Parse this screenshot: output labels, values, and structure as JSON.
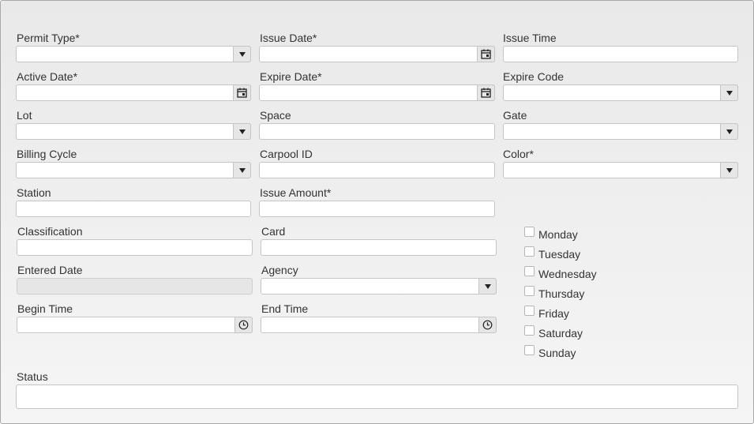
{
  "form": {
    "permit_type": {
      "label": "Permit Type*",
      "value": ""
    },
    "issue_date": {
      "label": "Issue Date*",
      "value": ""
    },
    "issue_time": {
      "label": "Issue Time",
      "value": ""
    },
    "active_date": {
      "label": "Active Date*",
      "value": ""
    },
    "expire_date": {
      "label": "Expire Date*",
      "value": ""
    },
    "expire_code": {
      "label": "Expire Code",
      "value": ""
    },
    "lot": {
      "label": "Lot",
      "value": ""
    },
    "space": {
      "label": "Space",
      "value": ""
    },
    "gate": {
      "label": "Gate",
      "value": ""
    },
    "billing_cycle": {
      "label": "Billing Cycle",
      "value": ""
    },
    "carpool_id": {
      "label": "Carpool ID",
      "value": ""
    },
    "color": {
      "label": "Color*",
      "value": ""
    },
    "station": {
      "label": "Station",
      "value": ""
    },
    "issue_amount": {
      "label": "Issue Amount*",
      "value": ""
    },
    "classification": {
      "label": "Classification",
      "value": ""
    },
    "card": {
      "label": "Card",
      "value": ""
    },
    "entered_date": {
      "label": "Entered Date",
      "value": ""
    },
    "agency": {
      "label": "Agency",
      "value": ""
    },
    "begin_time": {
      "label": "Begin Time",
      "value": ""
    },
    "end_time": {
      "label": "End Time",
      "value": ""
    },
    "status": {
      "label": "Status",
      "value": ""
    }
  },
  "days": [
    {
      "label": "Monday",
      "checked": false
    },
    {
      "label": "Tuesday",
      "checked": false
    },
    {
      "label": "Wednesday",
      "checked": false
    },
    {
      "label": "Thursday",
      "checked": false
    },
    {
      "label": "Friday",
      "checked": false
    },
    {
      "label": "Saturday",
      "checked": false
    },
    {
      "label": "Sunday",
      "checked": false
    }
  ],
  "icons": {
    "dropdown": "chevron-down-icon",
    "date": "calendar-icon",
    "time": "clock-icon"
  }
}
